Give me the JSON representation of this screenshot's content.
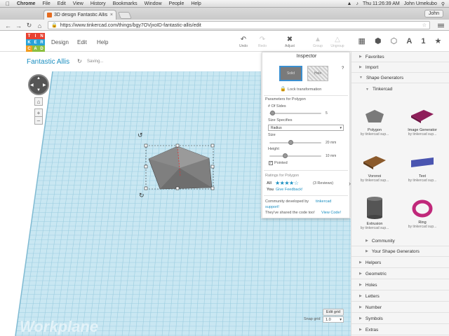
{
  "menubar": {
    "app": "Chrome",
    "items": [
      "File",
      "Edit",
      "View",
      "History",
      "Bookmarks",
      "Window",
      "People",
      "Help"
    ],
    "clock": "Thu 11:26:39 AM",
    "user": "John Umekubo"
  },
  "browser": {
    "tab_title": "3D design Fantastic Allis",
    "user_button": "John",
    "url": "https://www.tinkercad.com/things/bgy7OVjxoID-fantastic-allis/edit"
  },
  "app": {
    "logo": [
      "T",
      "I",
      "N",
      "K",
      "E",
      "R",
      "C",
      "A",
      "D"
    ],
    "logo_colors": [
      "#e8402f",
      "#e8402f",
      "#e8402f",
      "#27a2d8",
      "#27a2d8",
      "#27a2d8",
      "#f29c1f",
      "#8cbf3f",
      "#8cbf3f"
    ],
    "top_menu": [
      "Design",
      "Edit",
      "Help"
    ],
    "tools": {
      "undo": "Undo",
      "redo": "Redo",
      "adjust": "Adjust",
      "group": "Group",
      "ungroup": "Ungroup"
    },
    "design_name": "Fantastic Allis",
    "saving": "Saving..."
  },
  "inspector": {
    "title": "Inspector",
    "help": "?",
    "solid": "Solid",
    "hole": "Hole",
    "lock": "Lock transformation",
    "params_title": "Parameters for Polygon",
    "sides_label": "# Of Sides",
    "sides_value": "5",
    "sides_fraction": 0.05,
    "size_spec_label": "Size Specifies",
    "size_spec_value": "Radius",
    "size_label": "Size",
    "size_value": "20 mm",
    "size_fraction": 0.4,
    "height_label": "Height",
    "height_value": "10 mm",
    "height_fraction": 0.3,
    "pointed_label": "Pointed",
    "ratings_title": "Ratings for Polygon",
    "ratings_all": "All",
    "stars": 4,
    "reviews": "(3 Reviews)",
    "you": "You",
    "give_feedback": "Give Feedback!",
    "community_text": "Community developed by",
    "community_link": "tinkercad",
    "support": "support!",
    "shared_text": "They've shared the code too!",
    "view_code": "View Code!"
  },
  "right_panel": {
    "sections_top": [
      "Favorites",
      "Import",
      "Shape Generators"
    ],
    "tinkercad": "Tinkercad",
    "shapes": [
      {
        "name": "Polygon",
        "by": "by tinkercad sup...",
        "color": "#7a7a7a",
        "icon": "polygon-icon"
      },
      {
        "name": "Image Generator",
        "by": "by tinkercad sup...",
        "color": "#8e1f5a",
        "icon": "image-generator-icon"
      },
      {
        "name": "Voronoi",
        "by": "by tinkercad sup...",
        "color": "#8b5a2b",
        "icon": "voronoi-icon"
      },
      {
        "name": "Text",
        "by": "by tinkercad sup...",
        "color": "#4a55b0",
        "icon": "text-icon"
      },
      {
        "name": "Extrusion",
        "by": "by tinkercad sup...",
        "color": "#555",
        "icon": "extrusion-icon"
      },
      {
        "name": "Ring",
        "by": "by tinkercad sup...",
        "color": "#c0287a",
        "icon": "ring-icon"
      }
    ],
    "sections_sub": [
      "Community",
      "Your Shape Generators"
    ],
    "sections_bottom": [
      "Helpers",
      "Geometric",
      "Holes",
      "Letters",
      "Number",
      "Symbols",
      "Extras"
    ]
  },
  "workplane": {
    "label": "Workplane",
    "edit_grid": "Edit grid",
    "snap_label": "Snap grid",
    "snap_value": "1.0"
  }
}
